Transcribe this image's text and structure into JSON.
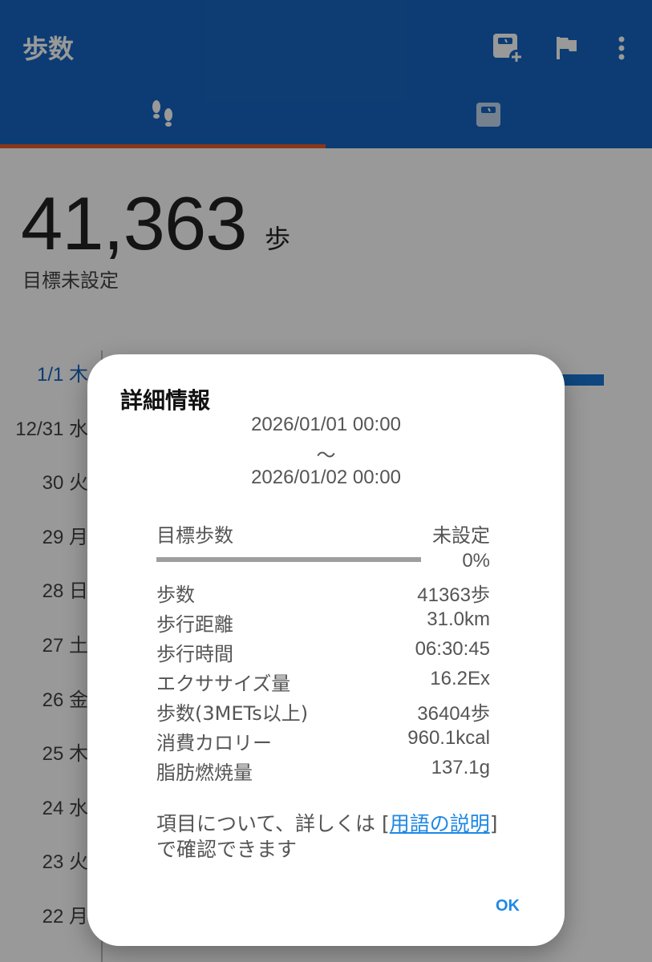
{
  "colors": {
    "primary": "#1565c0",
    "tab_indicator": "#e65a2c",
    "link": "#1e88e5"
  },
  "appbar": {
    "title": "歩数",
    "actions": [
      {
        "icon": "scale-add-icon"
      },
      {
        "icon": "flag-icon"
      },
      {
        "icon": "more-vert-icon"
      }
    ]
  },
  "tabs": [
    {
      "icon": "footprints-icon",
      "selected": true
    },
    {
      "icon": "scale-icon",
      "selected": false
    }
  ],
  "summary": {
    "steps": "41,363",
    "unit": "歩",
    "goal_text": "目標未設定"
  },
  "date_list": [
    "1/1 木",
    "12/31 水",
    "30 火",
    "29 月",
    "28 日",
    "27 土",
    "26 金",
    "25 木",
    "24 水",
    "23 火",
    "22 月"
  ],
  "dialog": {
    "title": "詳細情報",
    "range_start": "2026/01/01 00:00",
    "range_sep": "〜",
    "range_end": "2026/01/02 00:00",
    "goal_label": "目標歩数",
    "goal_value": "未設定",
    "progress_percent": 0,
    "progress_label": "0%",
    "rows": [
      {
        "label": "歩数",
        "value": "41363歩"
      },
      {
        "label": "歩行距離",
        "value": "31.0km"
      },
      {
        "label": "歩行時間",
        "value": "06:30:45"
      },
      {
        "label": "エクササイズ量",
        "value": "16.2Ex"
      },
      {
        "label": "歩数(3METs以上)",
        "value": "36404歩"
      },
      {
        "label": "消費カロリー",
        "value": "960.1kcal"
      },
      {
        "label": "脂肪燃焼量",
        "value": "137.1g"
      }
    ],
    "note_prefix": "項目について、詳しくは [",
    "note_link": "用語の説明",
    "note_suffix": "] で確認できます",
    "ok_label": "OK"
  }
}
